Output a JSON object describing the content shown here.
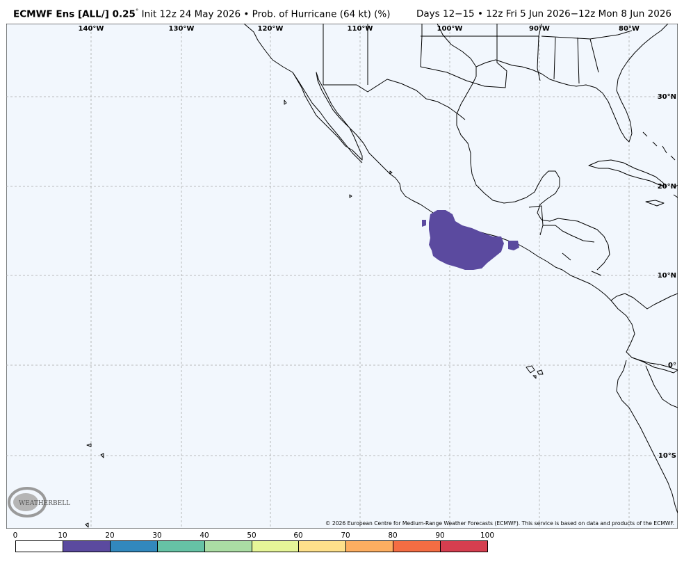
{
  "header": {
    "title_bold": "ECMWF Ens [ALL/] 0.25",
    "title_degree": "°",
    "title_rest": " Init 12z 24 May 2026 • Prob. of Hurricane (64 kt) (%)",
    "right": "Days 12−15 • 12z Fri 5 Jun 2026−12z Mon 8 Jun 2026"
  },
  "map": {
    "background": "#f2f7fd",
    "coastline_color": "#000000",
    "grid_color": "#a8a8a8",
    "lon_labels": [
      "140°W",
      "130°W",
      "120°W",
      "110°W",
      "100°W",
      "90°W",
      "80°W"
    ],
    "lat_labels": [
      "30°N",
      "20°N",
      "10°N",
      "0°",
      "10°S"
    ],
    "probability_area": {
      "probability_pct": "10–20",
      "color": "#5b4a9f"
    },
    "copyright": "© 2026 European Centre for Medium-Range Weather Forecasts (ECMWF). This service is based on data and products of the ECMWF.",
    "logo_text": "WEATHERBELL"
  },
  "colorbar": {
    "labels": [
      "0",
      "10",
      "20",
      "30",
      "40",
      "50",
      "60",
      "70",
      "80",
      "90",
      "100"
    ],
    "colors": [
      "#ffffff",
      "#5b4a9f",
      "#3288bd",
      "#66c2a5",
      "#abdda4",
      "#e6f598",
      "#fee08b",
      "#fdae61",
      "#f46d43",
      "#d53e4f",
      "#9e0142"
    ]
  }
}
